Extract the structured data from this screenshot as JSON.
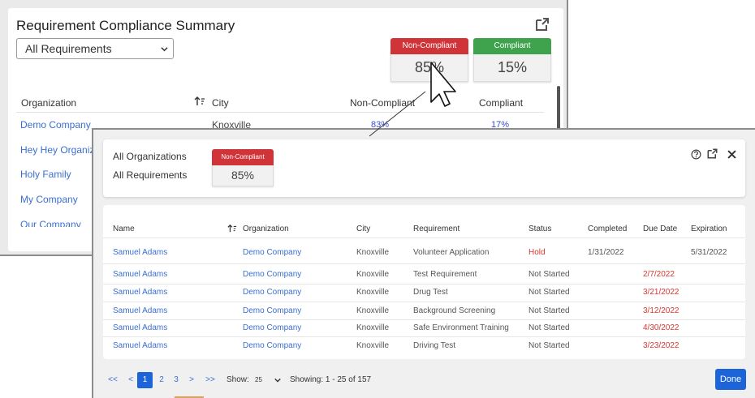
{
  "background": {
    "title": "Requirement Compliance Summary",
    "filter_value": "All Requirements",
    "non_compliant": {
      "label": "Non-Compliant",
      "value": "85%"
    },
    "compliant": {
      "label": "Compliant",
      "value": "15%"
    },
    "columns": [
      "Organization",
      "City",
      "Non-Compliant",
      "Compliant"
    ],
    "rows": [
      {
        "organization": "Demo Company",
        "city": "Knoxville",
        "non_compliant": "83%",
        "compliant": "17%"
      },
      {
        "organization": "Hey Hey Organiza"
      },
      {
        "organization": "Holy Family"
      },
      {
        "organization": "My Company"
      },
      {
        "organization": "Our Company"
      }
    ]
  },
  "modal": {
    "scope_org": "All Organizations",
    "scope_req": "All Requirements",
    "non_compliant": {
      "label": "Non-Compliant",
      "value": "85%"
    },
    "columns": [
      "Name",
      "Organization",
      "City",
      "Requirement",
      "Status",
      "Completed",
      "Due Date",
      "Expiration"
    ],
    "rows": [
      {
        "name": "Samuel Adams",
        "organization": "Demo Company",
        "city": "Knoxville",
        "requirement": "Volunteer Application",
        "status": "Hold",
        "completed": "1/31/2022",
        "due": "",
        "expiration": "5/31/2022"
      },
      {
        "name": "Samuel Adams",
        "organization": "Demo Company",
        "city": "Knoxville",
        "requirement": "Test Requirement",
        "status": "Not Started",
        "completed": "",
        "due": "2/7/2022",
        "expiration": ""
      },
      {
        "name": "Samuel Adams",
        "organization": "Demo Company",
        "city": "Knoxville",
        "requirement": "Drug Test",
        "status": "Not Started",
        "completed": "",
        "due": "3/21/2022",
        "expiration": ""
      },
      {
        "name": "Samuel Adams",
        "organization": "Demo Company",
        "city": "Knoxville",
        "requirement": "Background Screening",
        "status": "Not Started",
        "completed": "",
        "due": "3/12/2022",
        "expiration": ""
      },
      {
        "name": "Samuel Adams",
        "organization": "Demo Company",
        "city": "Knoxville",
        "requirement": "Safe Environment Training",
        "status": "Not Started",
        "completed": "",
        "due": "4/30/2022",
        "expiration": ""
      },
      {
        "name": "Samuel Adams",
        "organization": "Demo Company",
        "city": "Knoxville",
        "requirement": "Driving Test",
        "status": "Not Started",
        "completed": "",
        "due": "3/23/2022",
        "expiration": ""
      }
    ],
    "pagination": {
      "first": "<<",
      "prev": "<",
      "pages": [
        "1",
        "2",
        "3"
      ],
      "next": ">",
      "last": ">>",
      "show_label": "Show:",
      "page_size": "25",
      "showing": "Showing: 1 - 25 of 157"
    },
    "done_label": "Done"
  },
  "colors": {
    "red": "#d13438",
    "green": "#3fa34d",
    "link": "#3a6fd0",
    "primary": "#1d64d8"
  },
  "icons": [
    "external-link-icon",
    "help-icon",
    "close-icon",
    "sort-icon",
    "chevron-down-icon",
    "cursor-icon"
  ]
}
